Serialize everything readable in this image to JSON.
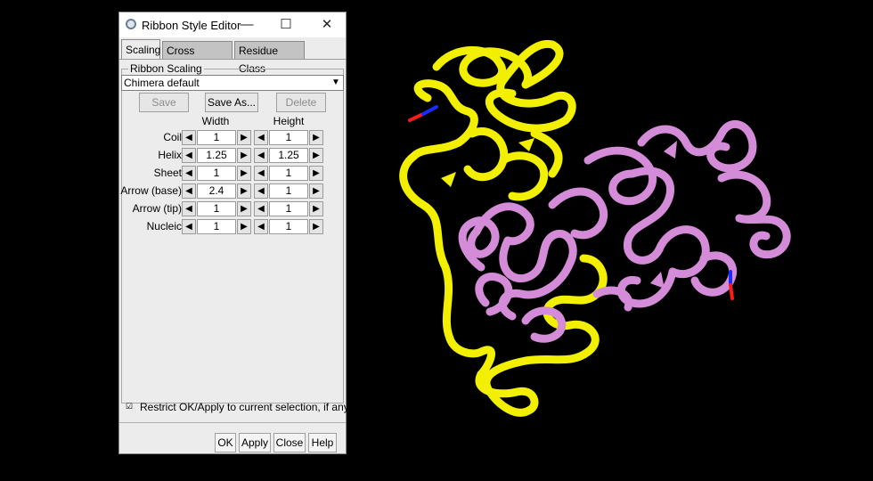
{
  "window": {
    "title": "Ribbon Style Editor",
    "minimize_glyph": "—",
    "maximize_glyph": "☐",
    "close_glyph": "✕"
  },
  "tabs": [
    {
      "label": "Scaling",
      "active": true
    },
    {
      "label": "Cross Section",
      "active": false
    },
    {
      "label": "Residue Class",
      "active": false
    }
  ],
  "scaling": {
    "group_label": "Ribbon Scaling",
    "preset": "Chimera default",
    "save_label": "Save",
    "save_as_label": "Save As...",
    "delete_label": "Delete",
    "width_header": "Width",
    "height_header": "Height",
    "rows": [
      {
        "label": "Coil",
        "width": "1",
        "height": "1"
      },
      {
        "label": "Helix",
        "width": "1.25",
        "height": "1.25"
      },
      {
        "label": "Sheet",
        "width": "1",
        "height": "1"
      },
      {
        "label": "Arrow (base)",
        "width": "2.4",
        "height": "1"
      },
      {
        "label": "Arrow (tip)",
        "width": "1",
        "height": "1"
      },
      {
        "label": "Nucleic",
        "width": "1",
        "height": "1"
      }
    ]
  },
  "restrict": {
    "checked": true,
    "label": "Restrict OK/Apply to current selection, if any"
  },
  "buttons": {
    "ok": "OK",
    "apply": "Apply",
    "close": "Close",
    "help": "Help"
  },
  "colors": {
    "chain_a": "#f2f000",
    "chain_b": "#d58cd8",
    "background": "#000000",
    "oxygen": "#ff1a1a",
    "nitrogen": "#1a2bff"
  }
}
